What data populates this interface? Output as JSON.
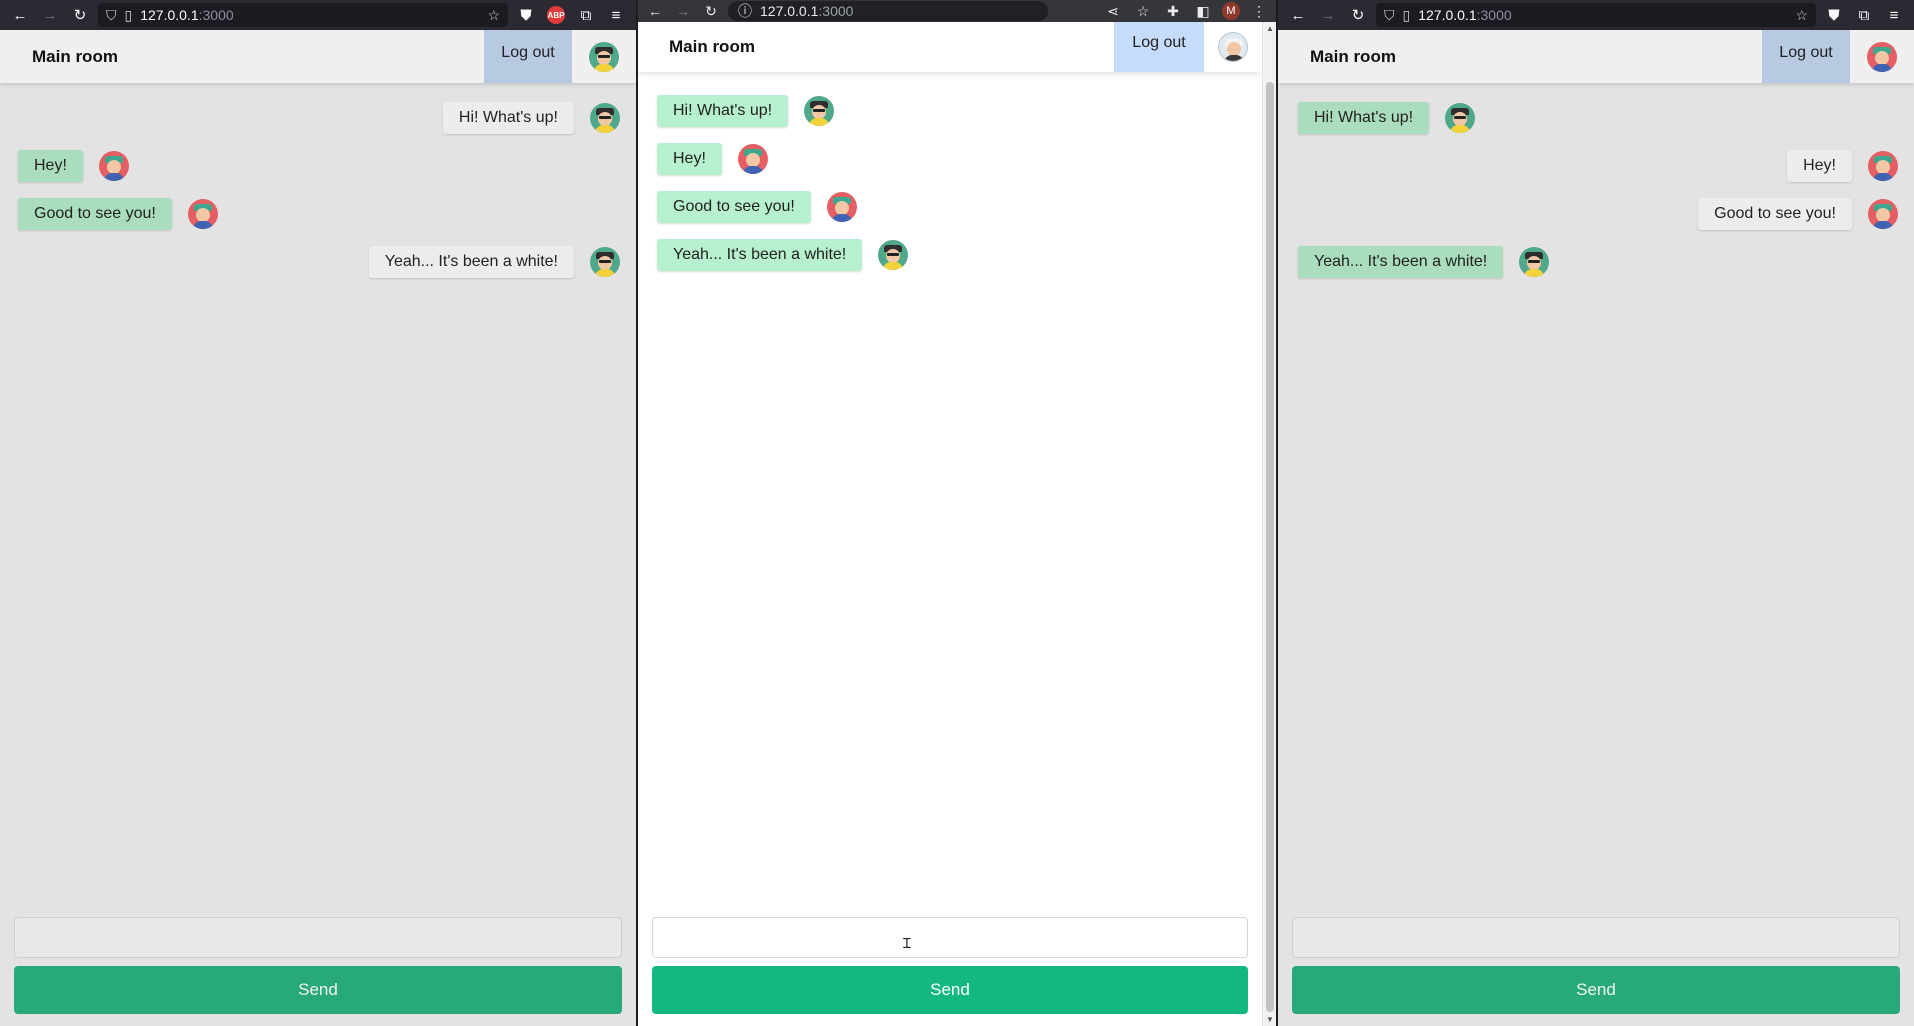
{
  "windows": {
    "left": {
      "browser": {
        "url_host": "127.0.0.1",
        "url_port": ":3000"
      },
      "header": {
        "room_title": "Main room",
        "logout_label": "Log out"
      },
      "messages": [
        {
          "text": "Hi! What's up!",
          "side": "right",
          "mine": false
        },
        {
          "text": "Hey!",
          "side": "left",
          "mine": true
        },
        {
          "text": "Good to see you!",
          "side": "left",
          "mine": true
        },
        {
          "text": "Yeah... It's been a white!",
          "side": "right",
          "mine": false
        }
      ],
      "composer": {
        "input_value": "",
        "send_label": "Send"
      }
    },
    "middle": {
      "browser": {
        "url_host": "127.0.0.1",
        "url_port": ":3000",
        "profile_initial": "M"
      },
      "header": {
        "room_title": "Main room",
        "logout_label": "Log out"
      },
      "messages": [
        {
          "text": "Hi! What's up!",
          "side": "left",
          "mine": true
        },
        {
          "text": "Hey!",
          "side": "left",
          "mine": true
        },
        {
          "text": "Good to see you!",
          "side": "left",
          "mine": true
        },
        {
          "text": "Yeah... It's been a white!",
          "side": "left",
          "mine": true
        }
      ],
      "composer": {
        "input_value": "",
        "send_label": "Send"
      }
    },
    "right": {
      "browser": {
        "url_host": "127.0.0.1",
        "url_port": ":3000"
      },
      "header": {
        "room_title": "Main room",
        "logout_label": "Log out"
      },
      "messages": [
        {
          "text": "Hi! What's up!",
          "side": "left",
          "mine": true
        },
        {
          "text": "Hey!",
          "side": "right",
          "mine": false
        },
        {
          "text": "Good to see you!",
          "side": "right",
          "mine": false
        },
        {
          "text": "Yeah... It's been a white!",
          "side": "left",
          "mine": true
        }
      ],
      "composer": {
        "input_value": "",
        "send_label": "Send"
      }
    }
  },
  "colors": {
    "send_button": "#27a97a",
    "send_button_active": "#12b880",
    "own_bubble": "#a9ddbd",
    "logout_bg": "#b8c9e2"
  }
}
